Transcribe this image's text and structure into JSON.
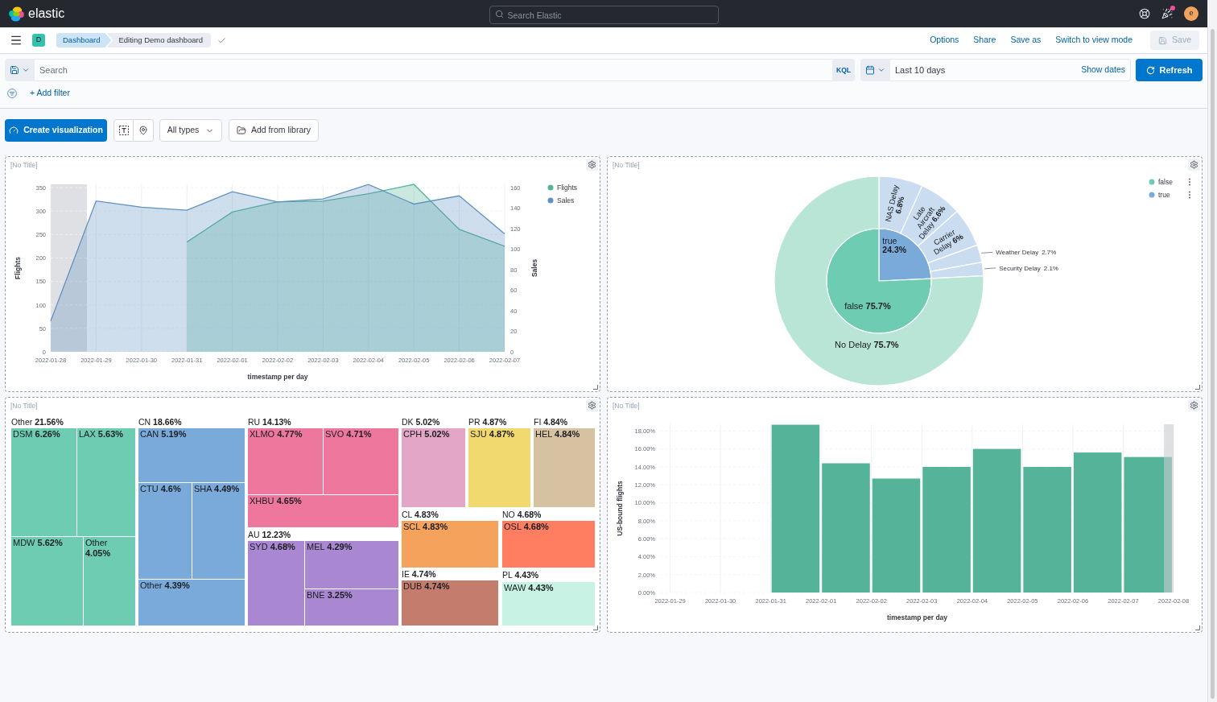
{
  "header": {
    "brand": "elastic",
    "search": {
      "placeholder": "Search Elastic"
    },
    "news_unread": true,
    "avatar": "e"
  },
  "nav": {
    "space": "D",
    "breadcrumbs": [
      {
        "label": "Dashboard",
        "current": false
      },
      {
        "label": "Editing Demo dashboard",
        "current": true
      }
    ],
    "actions": [
      {
        "label": "Options",
        "kind": "link",
        "disabled": false
      },
      {
        "label": "Share",
        "kind": "link",
        "disabled": false
      },
      {
        "label": "Save as",
        "kind": "link",
        "disabled": false
      },
      {
        "label": "Switch to view mode",
        "kind": "link",
        "disabled": false
      },
      {
        "label": "Save",
        "kind": "button",
        "disabled": true
      }
    ]
  },
  "query_bar": {
    "query": {
      "placeholder": "Search"
    },
    "language": "KQL",
    "date_range": "Last 10 days",
    "show_dates": "Show dates",
    "refresh": "Refresh",
    "add_filter": "+ Add filter"
  },
  "toolbar": {
    "create": "Create visualization",
    "type_filter": "All types",
    "add_from_library": "Add from library"
  },
  "panels": [
    {
      "kind": "chart",
      "title": "[No Title]",
      "chart_data": {
        "type": "area",
        "xlabel": "timestamp per day",
        "ylabel": "Flights",
        "y2label": "Sales",
        "categories": [
          "2022-01-28",
          "2022-01-29",
          "2022-01-30",
          "2022-01-31",
          "2022-02-01",
          "2022-02-02",
          "2022-02-03",
          "2022-02-04",
          "2022-02-05",
          "2022-02-06",
          "2022-02-07"
        ],
        "series": [
          {
            "name": "Flights",
            "color": "#54b399",
            "values": [
              null,
              null,
              null,
              234,
              298,
              320,
              321,
              337,
              357,
              261,
              225
            ]
          },
          {
            "name": "Sales",
            "color": "#6092c0",
            "axis": "y2",
            "values": [
              30,
              147,
              141,
              138,
              156,
              146,
              149,
              163,
              144,
              152,
              115
            ]
          }
        ],
        "ylim": [
          0,
          357
        ],
        "yticks": [
          0,
          50,
          100,
          150,
          200,
          250,
          300,
          350
        ],
        "y2lim": [
          0,
          163.2
        ],
        "y2ticks": [
          0,
          20,
          40,
          60,
          80,
          100,
          120,
          140,
          160
        ],
        "grid": true,
        "legend": true
      }
    },
    {
      "kind": "sunburst",
      "title": "[No Title]",
      "legend": [
        {
          "label": "false",
          "color": "#6dccb1"
        },
        {
          "label": "true",
          "color": "#79aad9"
        }
      ],
      "rings": [
        {
          "chart_data": {
            "type": "pie",
            "data_labels": true,
            "categories": [
              "true",
              "false"
            ],
            "values": [
              24.3,
              75.7
            ],
            "value_labels": [
              "24.3%",
              "75.7%"
            ],
            "colors": [
              "#79aad9",
              "#6dccb1"
            ]
          }
        },
        {
          "chart_data": {
            "type": "donut",
            "data_labels": true,
            "categories": [
              "NAS Delay",
              "Late Aircraft Delay",
              "Carrier Delay",
              "Weather Delay",
              "Security Delay",
              "No Delay"
            ],
            "values": [
              6.8,
              6.6,
              6,
              2.7,
              2.1,
              75.7
            ],
            "value_labels": [
              "6.8%",
              "6.6%",
              "6%",
              "2.7%",
              "2.1%",
              "75.7%"
            ],
            "colors": [
              "#c9dcf0",
              "#c9dcf0",
              "#c9dcf0",
              "#c9dcf0",
              "#c9dcf0",
              "#b9e5d7"
            ]
          }
        }
      ]
    },
    {
      "kind": "treemap",
      "title": "[No Title]",
      "groups": [
        {
          "name": "Other",
          "share": "21.56%",
          "color": "#6dccb1",
          "cells": [
            {
              "name": "DSM",
              "share": "6.26%"
            },
            {
              "name": "LAX",
              "share": "5.63%"
            },
            {
              "name": "MDW",
              "share": "5.62%"
            },
            {
              "name": "Other",
              "share": "4.05%"
            }
          ]
        },
        {
          "name": "CN",
          "share": "18.66%",
          "color": "#79aad9",
          "cells": [
            {
              "name": "CAN",
              "share": "5.19%"
            },
            {
              "name": "CTU",
              "share": "4.6%"
            },
            {
              "name": "SHA",
              "share": "4.49%"
            },
            {
              "name": "Other",
              "share": "4.39%"
            }
          ]
        },
        {
          "name": "RU",
          "share": "14.13%",
          "color": "#ee789d",
          "cells": [
            {
              "name": "XLMO",
              "share": "4.77%"
            },
            {
              "name": "SVO",
              "share": "4.71%"
            },
            {
              "name": "XHBU",
              "share": "4.65%"
            }
          ]
        },
        {
          "name": "AU",
          "share": "12.23%",
          "color": "#a987d1",
          "cells": [
            {
              "name": "SYD",
              "share": "4.68%"
            },
            {
              "name": "MEL",
              "share": "4.29%"
            },
            {
              "name": "BNE",
              "share": "3.25%"
            }
          ]
        },
        {
          "name": "DK",
          "share": "5.02%",
          "color": "#e4a6c7",
          "cells": [
            {
              "name": "CPH",
              "share": "5.02%"
            }
          ]
        },
        {
          "name": "PR",
          "share": "4.87%",
          "color": "#f1d86f",
          "cells": [
            {
              "name": "SJU",
              "share": "4.87%"
            }
          ]
        },
        {
          "name": "FI",
          "share": "4.84%",
          "color": "#d6c2a0",
          "cells": [
            {
              "name": "HEL",
              "share": "4.84%"
            }
          ]
        },
        {
          "name": "CL",
          "share": "4.83%",
          "color": "#f5a35c",
          "cells": [
            {
              "name": "SCL",
              "share": "4.83%"
            }
          ]
        },
        {
          "name": "IE",
          "share": "4.74%",
          "color": "#c47c6c",
          "cells": [
            {
              "name": "DUB",
              "share": "4.74%"
            }
          ]
        },
        {
          "name": "NO",
          "share": "4.68%",
          "color": "#ff7e62",
          "cells": [
            {
              "name": "OSL",
              "share": "4.68%"
            }
          ]
        },
        {
          "name": "PL",
          "share": "4.43%",
          "color": "#c8f2e4",
          "cells": [
            {
              "name": "WAW",
              "share": "4.43%"
            }
          ]
        }
      ]
    },
    {
      "kind": "chart",
      "title": "[No Title]",
      "chart_data": {
        "type": "bar",
        "xlabel": "timestamp per day",
        "ylabel": "US-bound flights",
        "categories": [
          "2022-01-29",
          "2022-01-30",
          "2022-01-31",
          "2022-02-01",
          "2022-02-02",
          "2022-02-03",
          "2022-02-04",
          "2022-02-05",
          "2022-02-06",
          "2022-02-07",
          "2022-02-08"
        ],
        "values": [
          null,
          null,
          18.7,
          14.4,
          12.7,
          14.0,
          16.0,
          14.0,
          15.6,
          15.1,
          null
        ],
        "ylim": [
          0,
          18.75
        ],
        "yticks": [
          {
            "value": 0,
            "label": "0.00%"
          },
          {
            "value": 2,
            "label": "2.00%"
          },
          {
            "value": 4,
            "label": "4.00%"
          },
          {
            "value": 6,
            "label": "6.00%"
          },
          {
            "value": 8,
            "label": "8.00%"
          },
          {
            "value": 10,
            "label": "10.00%"
          },
          {
            "value": 12,
            "label": "12.00%"
          },
          {
            "value": 14,
            "label": "14.00%"
          },
          {
            "value": 16,
            "label": "16.00%"
          },
          {
            "value": 18,
            "label": "18.00%"
          }
        ],
        "grid": true
      }
    }
  ]
}
